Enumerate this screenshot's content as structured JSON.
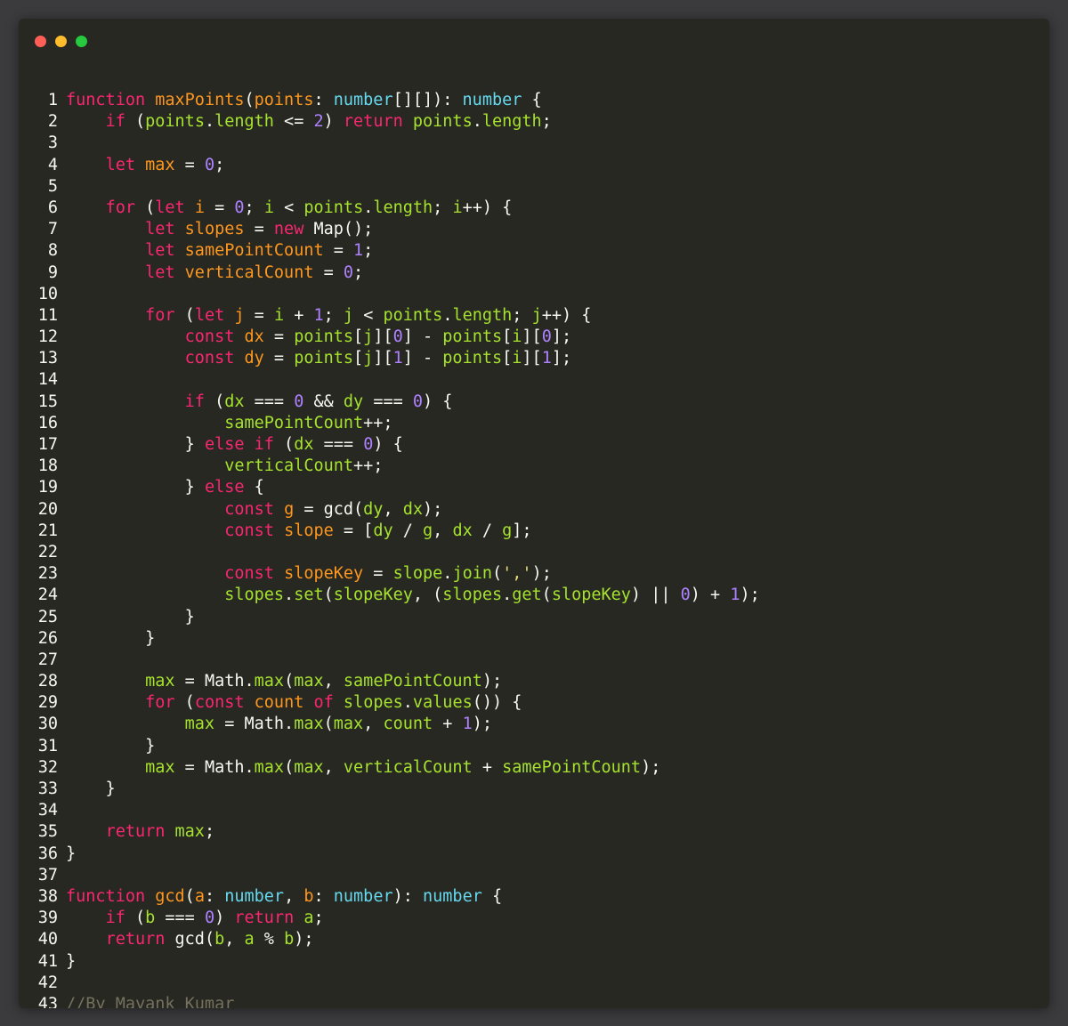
{
  "window": {
    "traffic_lights": [
      {
        "name": "close",
        "color": "#ff5f56"
      },
      {
        "name": "minimize",
        "color": "#ffbd2e"
      },
      {
        "name": "zoom",
        "color": "#27c93f"
      }
    ]
  },
  "theme": {
    "k": "#f92672",
    "f": "#fd971f",
    "t": "#66d9ef",
    "n": "#ae81ff",
    "v": "#a6e22e",
    "m": "#a6e22e",
    "s": "#e6db74",
    "c": "#75715e",
    "p": "#f8f8f2",
    "w": "#f8f8f2"
  },
  "code_lines": [
    [
      [
        "k",
        "function "
      ],
      [
        "f",
        "maxPoints"
      ],
      [
        "p",
        "("
      ],
      [
        "f",
        "points"
      ],
      [
        "p",
        ": "
      ],
      [
        "t",
        "number"
      ],
      [
        "p",
        "[][]): "
      ],
      [
        "t",
        "number"
      ],
      [
        "p",
        " {"
      ]
    ],
    [
      [
        "p",
        "    "
      ],
      [
        "k",
        "if"
      ],
      [
        "p",
        " ("
      ],
      [
        "v",
        "points"
      ],
      [
        "p",
        "."
      ],
      [
        "m",
        "length"
      ],
      [
        "p",
        " <= "
      ],
      [
        "n",
        "2"
      ],
      [
        "p",
        ") "
      ],
      [
        "k",
        "return"
      ],
      [
        "p",
        " "
      ],
      [
        "v",
        "points"
      ],
      [
        "p",
        "."
      ],
      [
        "m",
        "length"
      ],
      [
        "p",
        ";"
      ]
    ],
    [],
    [
      [
        "p",
        "    "
      ],
      [
        "k",
        "let"
      ],
      [
        "p",
        " "
      ],
      [
        "f",
        "max"
      ],
      [
        "p",
        " = "
      ],
      [
        "n",
        "0"
      ],
      [
        "p",
        ";"
      ]
    ],
    [],
    [
      [
        "p",
        "    "
      ],
      [
        "k",
        "for"
      ],
      [
        "p",
        " ("
      ],
      [
        "k",
        "let"
      ],
      [
        "p",
        " "
      ],
      [
        "f",
        "i"
      ],
      [
        "p",
        " = "
      ],
      [
        "n",
        "0"
      ],
      [
        "p",
        "; "
      ],
      [
        "v",
        "i"
      ],
      [
        "p",
        " < "
      ],
      [
        "v",
        "points"
      ],
      [
        "p",
        "."
      ],
      [
        "m",
        "length"
      ],
      [
        "p",
        "; "
      ],
      [
        "v",
        "i"
      ],
      [
        "p",
        "++) {"
      ]
    ],
    [
      [
        "p",
        "        "
      ],
      [
        "k",
        "let"
      ],
      [
        "p",
        " "
      ],
      [
        "f",
        "slopes"
      ],
      [
        "p",
        " = "
      ],
      [
        "k",
        "new"
      ],
      [
        "p",
        " Map();"
      ]
    ],
    [
      [
        "p",
        "        "
      ],
      [
        "k",
        "let"
      ],
      [
        "p",
        " "
      ],
      [
        "f",
        "samePointCount"
      ],
      [
        "p",
        " = "
      ],
      [
        "n",
        "1"
      ],
      [
        "p",
        ";"
      ]
    ],
    [
      [
        "p",
        "        "
      ],
      [
        "k",
        "let"
      ],
      [
        "p",
        " "
      ],
      [
        "f",
        "verticalCount"
      ],
      [
        "p",
        " = "
      ],
      [
        "n",
        "0"
      ],
      [
        "p",
        ";"
      ]
    ],
    [],
    [
      [
        "p",
        "        "
      ],
      [
        "k",
        "for"
      ],
      [
        "p",
        " ("
      ],
      [
        "k",
        "let"
      ],
      [
        "p",
        " "
      ],
      [
        "f",
        "j"
      ],
      [
        "p",
        " = "
      ],
      [
        "v",
        "i"
      ],
      [
        "p",
        " + "
      ],
      [
        "n",
        "1"
      ],
      [
        "p",
        "; "
      ],
      [
        "v",
        "j"
      ],
      [
        "p",
        " < "
      ],
      [
        "v",
        "points"
      ],
      [
        "p",
        "."
      ],
      [
        "m",
        "length"
      ],
      [
        "p",
        "; "
      ],
      [
        "v",
        "j"
      ],
      [
        "p",
        "++) {"
      ]
    ],
    [
      [
        "p",
        "            "
      ],
      [
        "k",
        "const"
      ],
      [
        "p",
        " "
      ],
      [
        "f",
        "dx"
      ],
      [
        "p",
        " = "
      ],
      [
        "v",
        "points"
      ],
      [
        "p",
        "["
      ],
      [
        "v",
        "j"
      ],
      [
        "p",
        "]["
      ],
      [
        "n",
        "0"
      ],
      [
        "p",
        "] - "
      ],
      [
        "v",
        "points"
      ],
      [
        "p",
        "["
      ],
      [
        "v",
        "i"
      ],
      [
        "p",
        "]["
      ],
      [
        "n",
        "0"
      ],
      [
        "p",
        "];"
      ]
    ],
    [
      [
        "p",
        "            "
      ],
      [
        "k",
        "const"
      ],
      [
        "p",
        " "
      ],
      [
        "f",
        "dy"
      ],
      [
        "p",
        " = "
      ],
      [
        "v",
        "points"
      ],
      [
        "p",
        "["
      ],
      [
        "v",
        "j"
      ],
      [
        "p",
        "]["
      ],
      [
        "n",
        "1"
      ],
      [
        "p",
        "] - "
      ],
      [
        "v",
        "points"
      ],
      [
        "p",
        "["
      ],
      [
        "v",
        "i"
      ],
      [
        "p",
        "]["
      ],
      [
        "n",
        "1"
      ],
      [
        "p",
        "];"
      ]
    ],
    [],
    [
      [
        "p",
        "            "
      ],
      [
        "k",
        "if"
      ],
      [
        "p",
        " ("
      ],
      [
        "v",
        "dx"
      ],
      [
        "p",
        " === "
      ],
      [
        "n",
        "0"
      ],
      [
        "p",
        " && "
      ],
      [
        "v",
        "dy"
      ],
      [
        "p",
        " === "
      ],
      [
        "n",
        "0"
      ],
      [
        "p",
        ") {"
      ]
    ],
    [
      [
        "p",
        "                "
      ],
      [
        "v",
        "samePointCount"
      ],
      [
        "p",
        "++;"
      ]
    ],
    [
      [
        "p",
        "            } "
      ],
      [
        "k",
        "else"
      ],
      [
        "p",
        " "
      ],
      [
        "k",
        "if"
      ],
      [
        "p",
        " ("
      ],
      [
        "v",
        "dx"
      ],
      [
        "p",
        " === "
      ],
      [
        "n",
        "0"
      ],
      [
        "p",
        ") {"
      ]
    ],
    [
      [
        "p",
        "                "
      ],
      [
        "v",
        "verticalCount"
      ],
      [
        "p",
        "++;"
      ]
    ],
    [
      [
        "p",
        "            } "
      ],
      [
        "k",
        "else"
      ],
      [
        "p",
        " {"
      ]
    ],
    [
      [
        "p",
        "                "
      ],
      [
        "k",
        "const"
      ],
      [
        "p",
        " "
      ],
      [
        "f",
        "g"
      ],
      [
        "p",
        " = gcd("
      ],
      [
        "v",
        "dy"
      ],
      [
        "p",
        ", "
      ],
      [
        "v",
        "dx"
      ],
      [
        "p",
        ");"
      ]
    ],
    [
      [
        "p",
        "                "
      ],
      [
        "k",
        "const"
      ],
      [
        "p",
        " "
      ],
      [
        "f",
        "slope"
      ],
      [
        "p",
        " = ["
      ],
      [
        "v",
        "dy"
      ],
      [
        "p",
        " / "
      ],
      [
        "v",
        "g"
      ],
      [
        "p",
        ", "
      ],
      [
        "v",
        "dx"
      ],
      [
        "p",
        " / "
      ],
      [
        "v",
        "g"
      ],
      [
        "p",
        "];"
      ]
    ],
    [],
    [
      [
        "p",
        "                "
      ],
      [
        "k",
        "const"
      ],
      [
        "p",
        " "
      ],
      [
        "f",
        "slopeKey"
      ],
      [
        "p",
        " = "
      ],
      [
        "v",
        "slope"
      ],
      [
        "p",
        "."
      ],
      [
        "m",
        "join"
      ],
      [
        "p",
        "("
      ],
      [
        "s",
        "','"
      ],
      [
        "p",
        ");"
      ]
    ],
    [
      [
        "p",
        "                "
      ],
      [
        "v",
        "slopes"
      ],
      [
        "p",
        "."
      ],
      [
        "m",
        "set"
      ],
      [
        "p",
        "("
      ],
      [
        "v",
        "slopeKey"
      ],
      [
        "p",
        ", ("
      ],
      [
        "v",
        "slopes"
      ],
      [
        "p",
        "."
      ],
      [
        "m",
        "get"
      ],
      [
        "p",
        "("
      ],
      [
        "v",
        "slopeKey"
      ],
      [
        "p",
        ") || "
      ],
      [
        "n",
        "0"
      ],
      [
        "p",
        ") + "
      ],
      [
        "n",
        "1"
      ],
      [
        "p",
        ");"
      ]
    ],
    [
      [
        "p",
        "            }"
      ]
    ],
    [
      [
        "p",
        "        }"
      ]
    ],
    [],
    [
      [
        "p",
        "        "
      ],
      [
        "v",
        "max"
      ],
      [
        "p",
        " = Math."
      ],
      [
        "m",
        "max"
      ],
      [
        "p",
        "("
      ],
      [
        "v",
        "max"
      ],
      [
        "p",
        ", "
      ],
      [
        "v",
        "samePointCount"
      ],
      [
        "p",
        ");"
      ]
    ],
    [
      [
        "p",
        "        "
      ],
      [
        "k",
        "for"
      ],
      [
        "p",
        " ("
      ],
      [
        "k",
        "const"
      ],
      [
        "p",
        " "
      ],
      [
        "f",
        "count"
      ],
      [
        "p",
        " "
      ],
      [
        "k",
        "of"
      ],
      [
        "p",
        " "
      ],
      [
        "v",
        "slopes"
      ],
      [
        "p",
        "."
      ],
      [
        "m",
        "values"
      ],
      [
        "p",
        "()) {"
      ]
    ],
    [
      [
        "p",
        "            "
      ],
      [
        "v",
        "max"
      ],
      [
        "p",
        " = Math."
      ],
      [
        "m",
        "max"
      ],
      [
        "p",
        "("
      ],
      [
        "v",
        "max"
      ],
      [
        "p",
        ", "
      ],
      [
        "v",
        "count"
      ],
      [
        "p",
        " + "
      ],
      [
        "n",
        "1"
      ],
      [
        "p",
        ");"
      ]
    ],
    [
      [
        "p",
        "        }"
      ]
    ],
    [
      [
        "p",
        "        "
      ],
      [
        "v",
        "max"
      ],
      [
        "p",
        " = Math."
      ],
      [
        "m",
        "max"
      ],
      [
        "p",
        "("
      ],
      [
        "v",
        "max"
      ],
      [
        "p",
        ", "
      ],
      [
        "v",
        "verticalCount"
      ],
      [
        "p",
        " + "
      ],
      [
        "v",
        "samePointCount"
      ],
      [
        "p",
        ");"
      ]
    ],
    [
      [
        "p",
        "    }"
      ]
    ],
    [],
    [
      [
        "p",
        "    "
      ],
      [
        "k",
        "return"
      ],
      [
        "p",
        " "
      ],
      [
        "v",
        "max"
      ],
      [
        "p",
        ";"
      ]
    ],
    [
      [
        "p",
        "}"
      ]
    ],
    [],
    [
      [
        "k",
        "function "
      ],
      [
        "f",
        "gcd"
      ],
      [
        "p",
        "("
      ],
      [
        "f",
        "a"
      ],
      [
        "p",
        ": "
      ],
      [
        "t",
        "number"
      ],
      [
        "p",
        ", "
      ],
      [
        "f",
        "b"
      ],
      [
        "p",
        ": "
      ],
      [
        "t",
        "number"
      ],
      [
        "p",
        "): "
      ],
      [
        "t",
        "number"
      ],
      [
        "p",
        " {"
      ]
    ],
    [
      [
        "p",
        "    "
      ],
      [
        "k",
        "if"
      ],
      [
        "p",
        " ("
      ],
      [
        "v",
        "b"
      ],
      [
        "p",
        " === "
      ],
      [
        "n",
        "0"
      ],
      [
        "p",
        ") "
      ],
      [
        "k",
        "return"
      ],
      [
        "p",
        " "
      ],
      [
        "v",
        "a"
      ],
      [
        "p",
        ";"
      ]
    ],
    [
      [
        "p",
        "    "
      ],
      [
        "k",
        "return"
      ],
      [
        "p",
        " gcd("
      ],
      [
        "v",
        "b"
      ],
      [
        "p",
        ", "
      ],
      [
        "v",
        "a"
      ],
      [
        "p",
        " % "
      ],
      [
        "v",
        "b"
      ],
      [
        "p",
        ");"
      ]
    ],
    [
      [
        "p",
        "}"
      ]
    ],
    [],
    [
      [
        "c",
        "//By Mayank Kumar"
      ]
    ]
  ]
}
